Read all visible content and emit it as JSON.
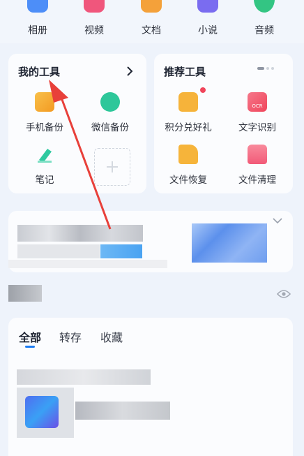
{
  "categories": [
    {
      "label": "相册",
      "icon": "album-icon",
      "color": "#4d8ef8"
    },
    {
      "label": "视频",
      "icon": "video-icon",
      "color": "#f0567c"
    },
    {
      "label": "文档",
      "icon": "document-icon",
      "color": "#f4a13a"
    },
    {
      "label": "小说",
      "icon": "novel-icon",
      "color": "#7a6cf0"
    },
    {
      "label": "音频",
      "icon": "audio-icon",
      "color": "#33c583"
    }
  ],
  "my_tools": {
    "title": "我的工具",
    "items": [
      {
        "label": "手机备份",
        "icon": "phone-backup-icon",
        "color": "#f6a92e"
      },
      {
        "label": "微信备份",
        "icon": "wechat-backup-icon",
        "color": "#2ec79a"
      },
      {
        "label": "笔记",
        "icon": "notes-icon",
        "color": "#2fc9a0"
      }
    ]
  },
  "recommended_tools": {
    "title": "推荐工具",
    "items": [
      {
        "label": "积分兑好礼",
        "icon": "gift-bag-icon",
        "color": "#f6b33a"
      },
      {
        "label": "文字识别",
        "icon": "ocr-icon",
        "color": "#f25a6f",
        "badge": "OCR"
      },
      {
        "label": "文件恢复",
        "icon": "file-recovery-icon",
        "color": "#f6b43a"
      },
      {
        "label": "文件清理",
        "icon": "file-cleanup-icon",
        "color": "#f25a78"
      }
    ]
  },
  "tabs": [
    {
      "label": "全部",
      "active": true
    },
    {
      "label": "转存",
      "active": false
    },
    {
      "label": "收藏",
      "active": false
    }
  ],
  "accent": "#1d7cf2",
  "annotation_color": "#e8403a"
}
